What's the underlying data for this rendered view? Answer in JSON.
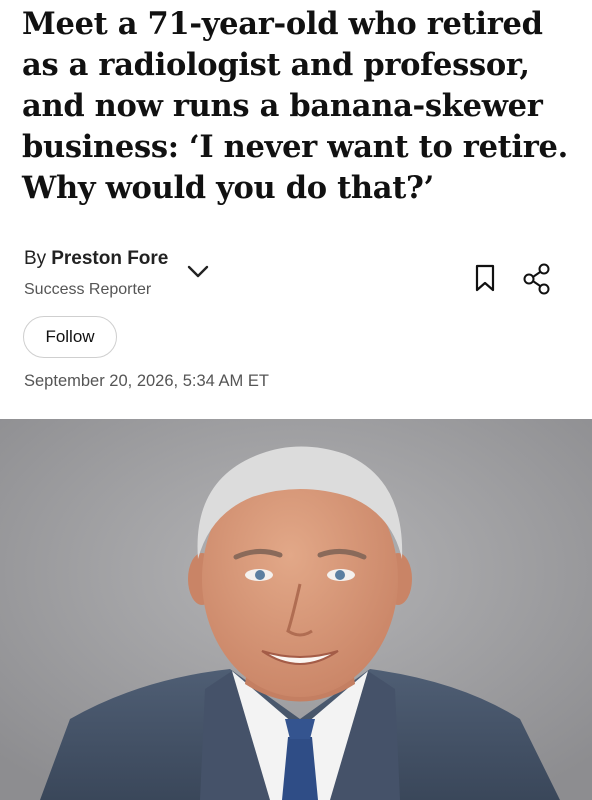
{
  "article": {
    "headline": "Meet a 71-year-old who retired as a radiologist and professor, and now runs a banana-skewer business: ‘I never want to retire. Why would you do that?’",
    "byline_prefix": "By",
    "author_name": "Preston Fore",
    "author_role": "Success Reporter",
    "follow_label": "Follow",
    "date": "September 20, 2026, 5:34 AM ET"
  },
  "icons": {
    "expand": "chevron-down-icon",
    "save": "bookmark-icon",
    "share": "share-icon"
  },
  "colors": {
    "text": "#111111",
    "muted": "#555555",
    "photo_background": "#9a9a9c"
  }
}
